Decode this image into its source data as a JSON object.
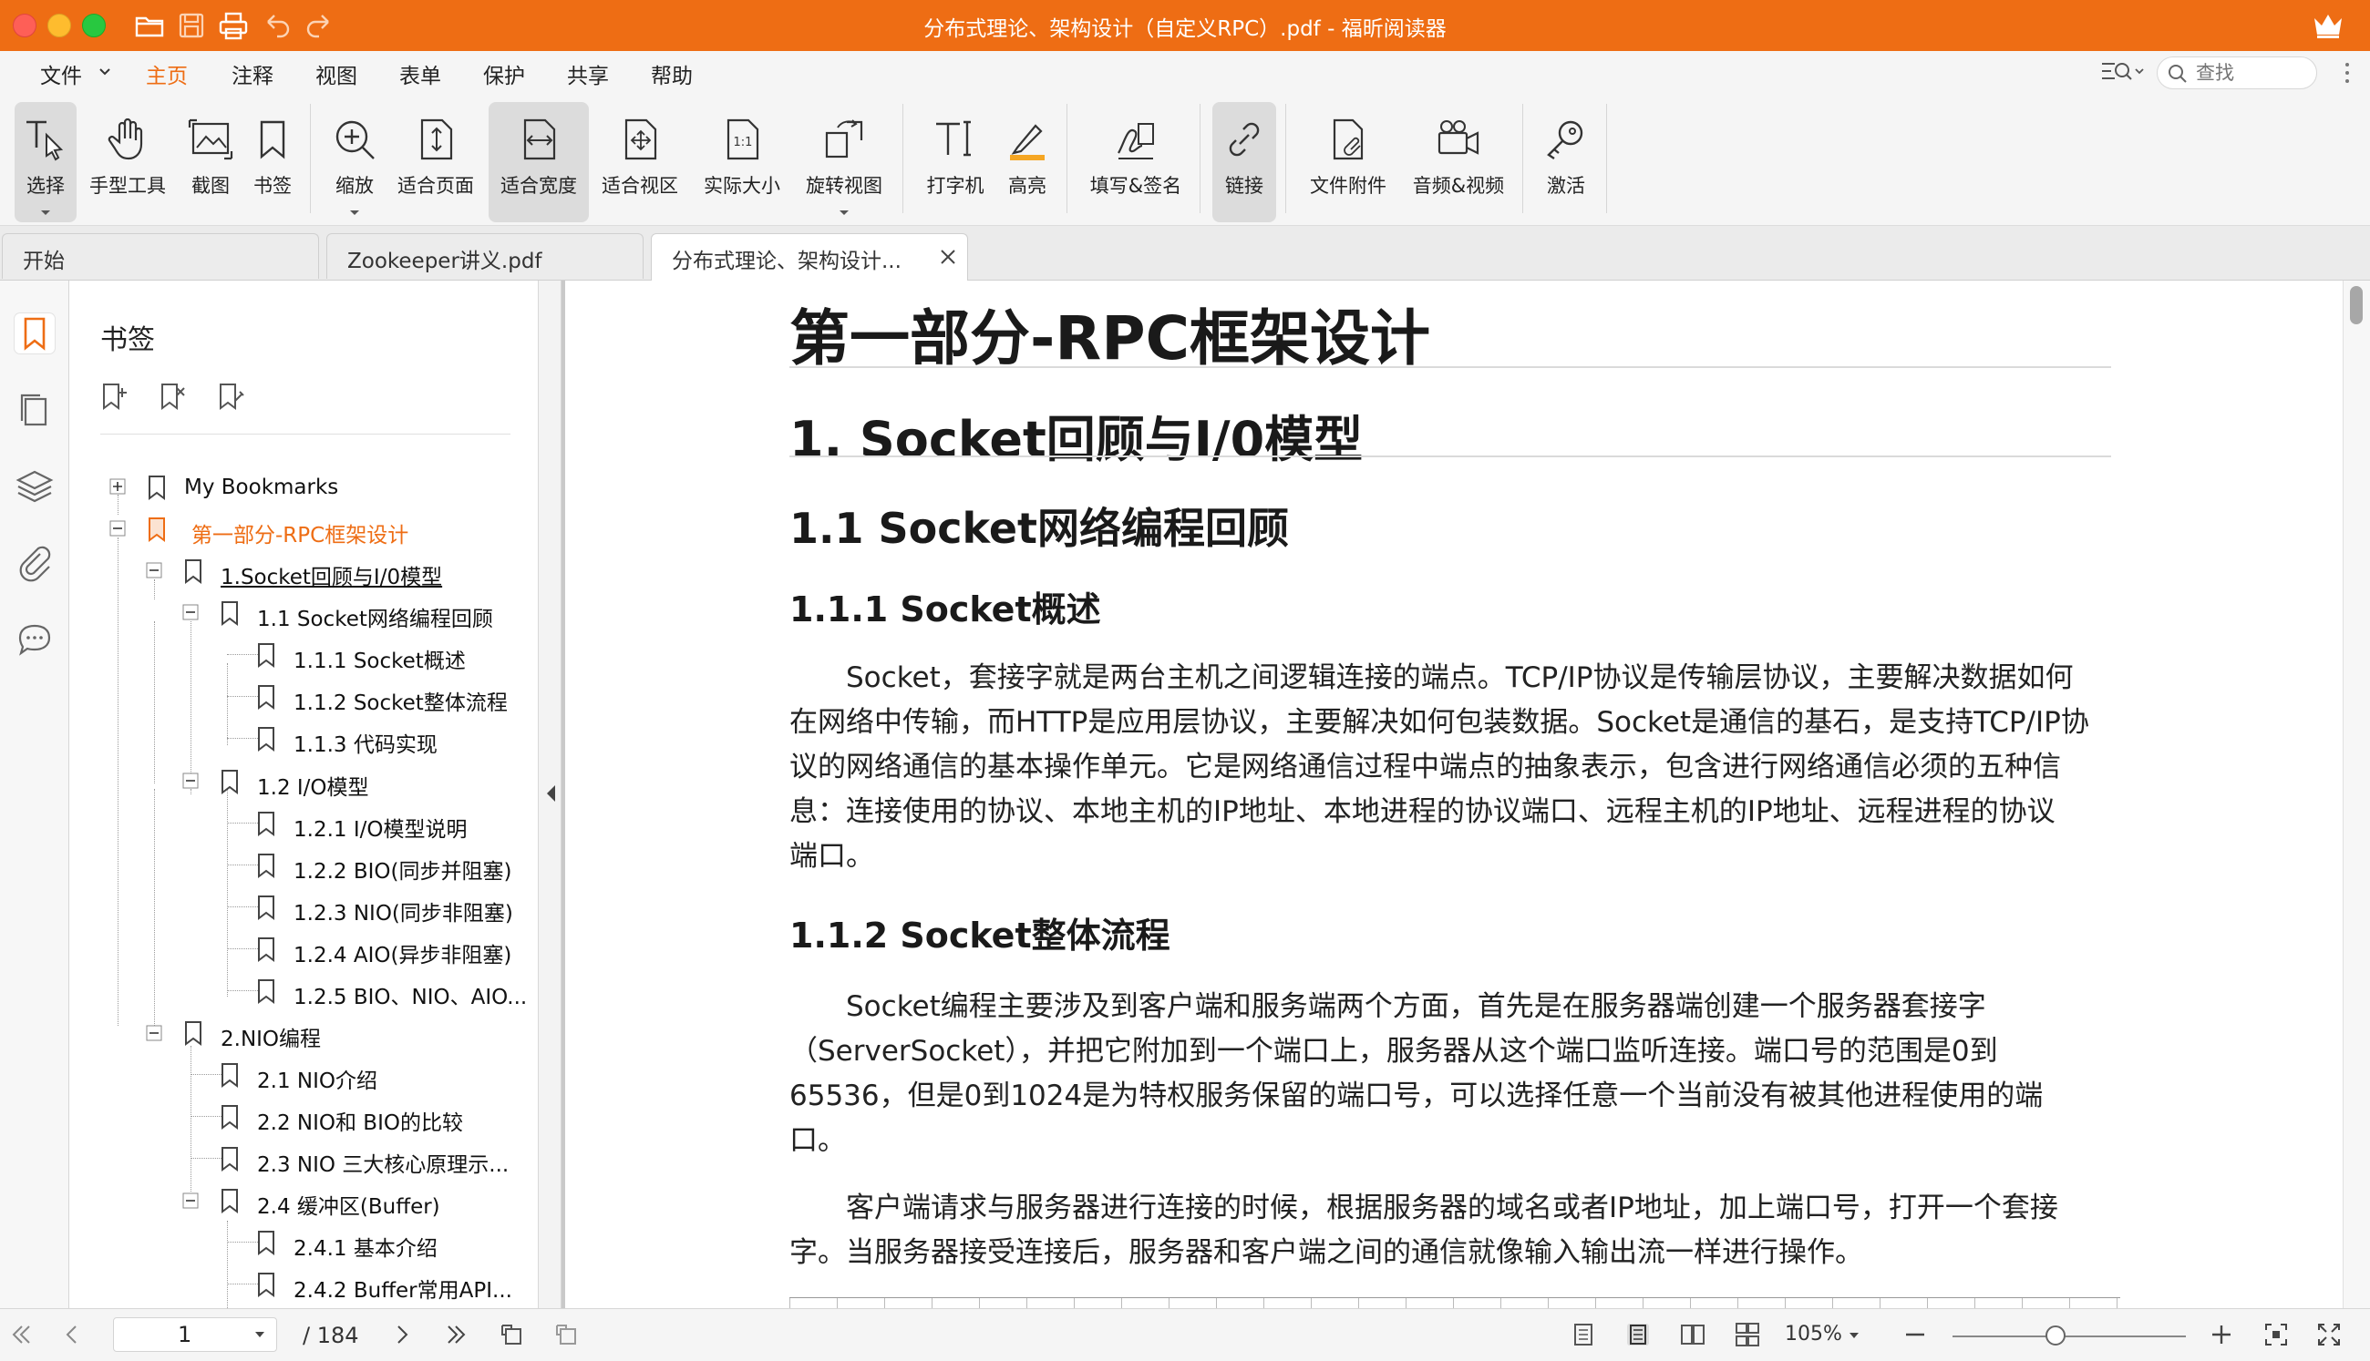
{
  "window": {
    "title": "分布式理论、架构设计（自定义RPC）.pdf - 福昕阅读器",
    "accent_color": "#ee6d14"
  },
  "menubar": {
    "items": [
      "文件",
      "主页",
      "注释",
      "视图",
      "表单",
      "保护",
      "共享",
      "帮助"
    ],
    "active": "主页",
    "search_placeholder": "查找"
  },
  "ribbon": {
    "buttons": [
      "选择",
      "手型工具",
      "截图",
      "书签",
      "缩放",
      "适合页面",
      "适合宽度",
      "适合视区",
      "实际大小",
      "旋转视图",
      "打字机",
      "高亮",
      "填写&签名",
      "链接",
      "文件附件",
      "音频&视频",
      "激活"
    ],
    "selected": [
      "适合宽度",
      "链接"
    ]
  },
  "tabs": [
    "开始",
    "Zookeeper讲义.pdf",
    "分布式理论、架构设计..."
  ],
  "bookmarks": {
    "title": "书签",
    "items": [
      "My Bookmarks",
      "第一部分-RPC框架设计",
      "1.Socket回顾与I/0模型",
      "1.1 Socket网络编程回顾",
      "1.1.1 Socket概述",
      "1.1.2 Socket整体流程",
      "1.1.3 代码实现",
      "1.2  I/O模型",
      "1.2.1 I/O模型说明",
      "1.2.2 BIO(同步并阻塞)",
      "1.2.3 NIO(同步非阻塞)",
      "1.2.4 AIO(异步非阻塞)",
      "1.2.5 BIO、NIO、AIO...",
      "2.NIO编程",
      "2.1 NIO介绍",
      "2.2  NIO和 BIO的比较",
      "2.3 NIO 三大核心原理示...",
      "2.4 缓冲区(Buffer)",
      "2.4.1 基本介绍",
      "2.4.2  Buffer常用API..."
    ]
  },
  "document": {
    "h1": "第一部分-RPC框架设计",
    "h2": "1. Socket回顾与I/0模型",
    "h3": "1.1 Socket网络编程回顾",
    "h4_1": "1.1.1 Socket概述",
    "p1": [
      "　　Socket，套接字就是两台主机之间逻辑连接的端点。TCP/IP协议是传输层协议，主要解决数据如何",
      "在网络中传输，而HTTP是应用层协议，主要解决如何包装数据。Socket是通信的基石，是支持TCP/IP协",
      "议的网络通信的基本操作单元。它是网络通信过程中端点的抽象表示，包含进行网络通信必须的五种信",
      "息：连接使用的协议、本地主机的IP地址、本地进程的协议端口、远程主机的IP地址、远程进程的协议",
      "端口。"
    ],
    "h4_2": "1.1.2 Socket整体流程",
    "p2": [
      "　　Socket编程主要涉及到客户端和服务端两个方面，首先是在服务器端创建一个服务器套接字",
      "（ServerSocket），并把它附加到一个端口上，服务器从这个端口监听连接。端口号的范围是0到",
      "65536，但是0到1024是为特权服务保留的端口号，可以选择任意一个当前没有被其他进程使用的端",
      "口。"
    ],
    "p3": [
      "　　客户端请求与服务器进行连接的时候，根据服务器的域名或者IP地址，加上端口号，打开一个套接",
      "字。当服务器接受连接后，服务器和客户端之间的通信就像输入输出流一样进行操作。"
    ]
  },
  "statusbar": {
    "current_page": "1",
    "total_pages": "/ 184",
    "zoom": "105%",
    "zoom_fraction": 0.44
  }
}
